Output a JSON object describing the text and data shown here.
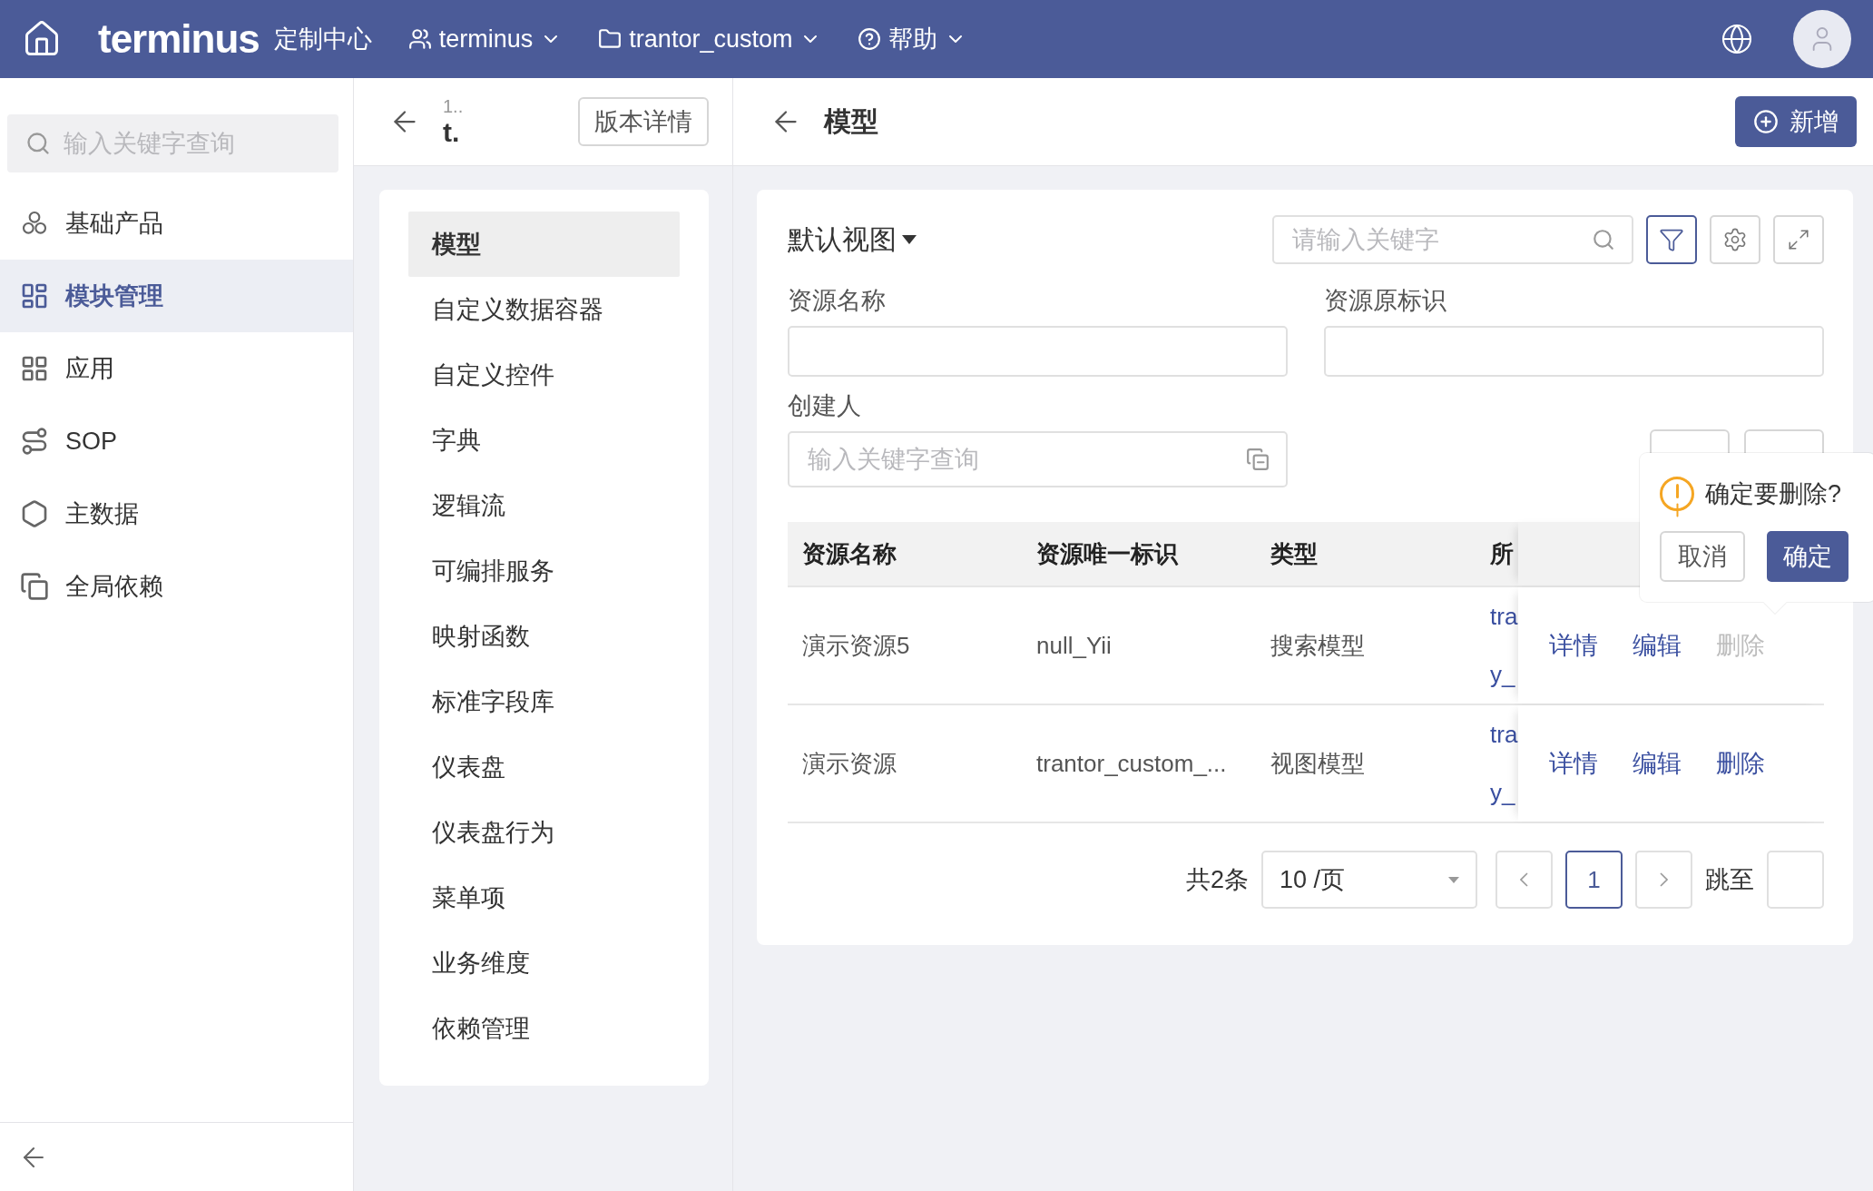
{
  "topbar": {
    "logo": "terminus",
    "product": "定制中心",
    "menus": [
      {
        "kind": "user",
        "label": "terminus"
      },
      {
        "kind": "project",
        "label": "trantor_custom"
      },
      {
        "kind": "help",
        "label": "帮助"
      }
    ]
  },
  "sidebar": {
    "search": {
      "placeholder": "输入关键字查询"
    },
    "items": [
      {
        "kind": "product",
        "label": "基础产品",
        "selected": false
      },
      {
        "kind": "module",
        "label": "模块管理",
        "selected": true
      },
      {
        "kind": "app",
        "label": "应用",
        "selected": false
      },
      {
        "kind": "sop",
        "label": "SOP",
        "selected": false
      },
      {
        "kind": "master",
        "label": "主数据",
        "selected": false
      },
      {
        "kind": "dependency",
        "label": "全局依赖",
        "selected": false
      }
    ]
  },
  "version_panel": {
    "version": "1..",
    "name": "t.",
    "button": "版本详情",
    "menu": [
      {
        "label": "模型",
        "selected": true
      },
      {
        "label": "自定义数据容器",
        "selected": false
      },
      {
        "label": "自定义控件",
        "selected": false
      },
      {
        "label": "字典",
        "selected": false
      },
      {
        "label": "逻辑流",
        "selected": false
      },
      {
        "label": "可编排服务",
        "selected": false
      },
      {
        "label": "映射函数",
        "selected": false
      },
      {
        "label": "标准字段库",
        "selected": false
      },
      {
        "label": "仪表盘",
        "selected": false
      },
      {
        "label": "仪表盘行为",
        "selected": false
      },
      {
        "label": "菜单项",
        "selected": false
      },
      {
        "label": "业务维度",
        "selected": false
      },
      {
        "label": "依赖管理",
        "selected": false
      }
    ]
  },
  "main": {
    "title": "模型",
    "add_button": "新增",
    "view": "默认视图",
    "search": {
      "placeholder": "请输入关键字"
    },
    "filter_active": true,
    "filters": [
      {
        "kind": "text",
        "label": "资源名称"
      },
      {
        "kind": "text",
        "label": "资源原标识"
      },
      {
        "kind": "select",
        "label": "创建人",
        "placeholder": "输入关键字查询"
      }
    ],
    "table": {
      "columns": [
        "资源名称",
        "资源唯一标识",
        "类型",
        "所"
      ],
      "rows": [
        {
          "cells": [
            "演示资源5",
            "null_Yii",
            "搜索模型"
          ],
          "link_lines": [
            "tra",
            "y_"
          ],
          "actions": [
            {
              "label": "详情",
              "disabled": false
            },
            {
              "label": "编辑",
              "disabled": false
            },
            {
              "label": "删除",
              "disabled": true
            }
          ]
        },
        {
          "cells": [
            "演示资源",
            "trantor_custom_...",
            "视图模型"
          ],
          "link_lines": [
            "tra",
            "y_"
          ],
          "actions": [
            {
              "label": "详情",
              "disabled": false
            },
            {
              "label": "编辑",
              "disabled": false
            },
            {
              "label": "删除",
              "disabled": false
            }
          ]
        }
      ]
    },
    "pagination": {
      "total": "共2条",
      "page_size": "10 /页",
      "pages": [
        {
          "label": "1",
          "selected": true
        }
      ],
      "jump_label": "跳至"
    },
    "popconfirm": {
      "message": "确定要删除?",
      "cancel": "取消",
      "confirm": "确定"
    }
  }
}
